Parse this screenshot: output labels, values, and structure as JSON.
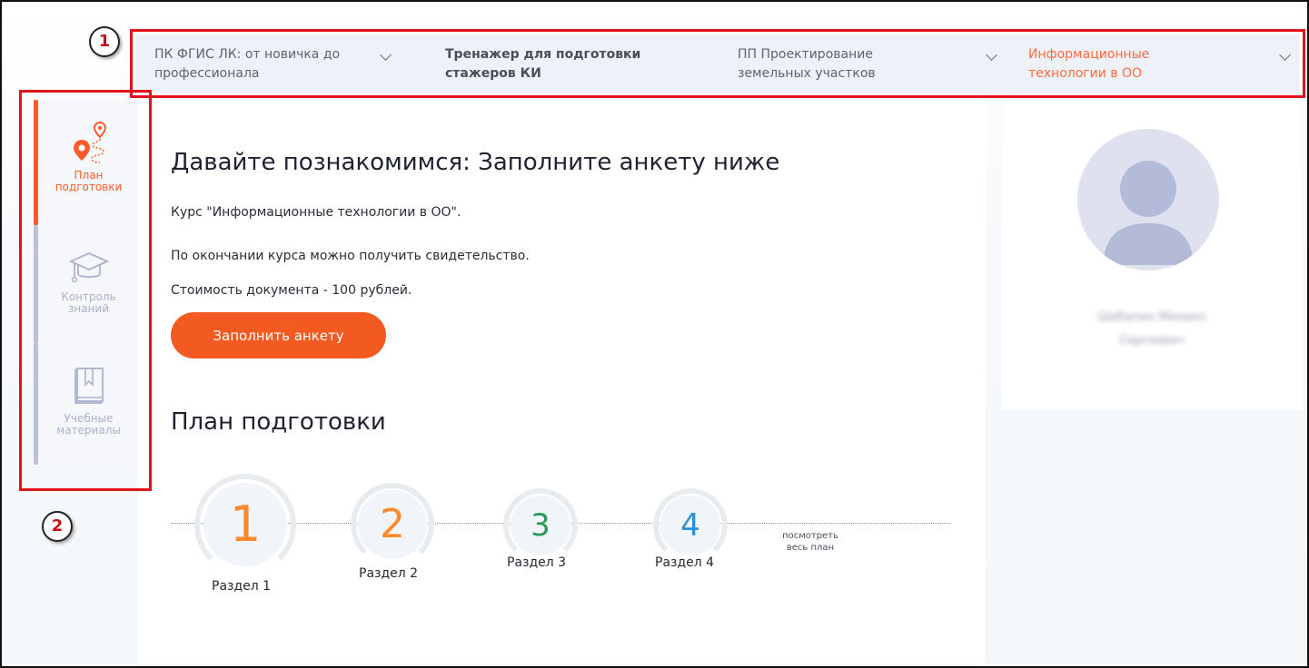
{
  "courses": [
    {
      "line1": "ПК ФГИС ЛК: от новичка до",
      "line2": "профессионала"
    },
    {
      "line1": "Тренажер для подготовки",
      "line2": "стажеров КИ"
    },
    {
      "line1": "ПП Проектирование",
      "line2": "земельных участков"
    },
    {
      "line1": "Информационные",
      "line2": "технологии в ОО"
    }
  ],
  "sidebar": {
    "items": [
      {
        "line1": "План",
        "line2": "подготовки",
        "icon": "route-map-pin-icon"
      },
      {
        "line1": "Контроль",
        "line2": "знаний",
        "icon": "graduation-cap-icon"
      },
      {
        "line1": "Учебные",
        "line2": "материалы",
        "icon": "book-icon"
      }
    ]
  },
  "main": {
    "heading": "Давайте познакомимся: Заполните анкету ниже",
    "course_text": "Курс \"Информационные технологии в ОО\".",
    "certificate_text": "По окончании курса можно получить свидетельство.",
    "cost_text": "Стоимость документа - 100 рублей.",
    "fill_button": "Заполнить анкету",
    "plan_heading": "План подготовки",
    "steps": [
      {
        "number": "1",
        "label": "Раздел 1",
        "color": "#ff8a2b"
      },
      {
        "number": "2",
        "label": "Раздел 2",
        "color": "#ff8a2b"
      },
      {
        "number": "3",
        "label": "Раздел 3",
        "color": "#2e9a5a"
      },
      {
        "number": "4",
        "label": "Раздел 4",
        "color": "#2f8fd6"
      }
    ],
    "view_plan_line1": "посмотреть",
    "view_plan_line2": "весь план"
  },
  "profile": {
    "name_line1": "Шабалин Михаил",
    "name_line2": "Сергеевич"
  },
  "annotations": {
    "badge1": "1",
    "badge2": "2"
  },
  "colors": {
    "accent": "#f25a22",
    "active_tab": "#ff6a3d",
    "annotation": "#e0141a"
  }
}
